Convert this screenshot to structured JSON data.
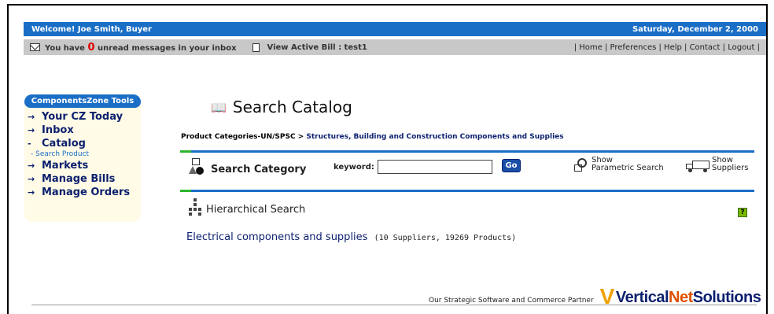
{
  "header": {
    "welcome": "Welcome! Joe Smith, Buyer",
    "date": "Saturday, December 2, 2000"
  },
  "subbar": {
    "msg_prefix": "You have",
    "unread_count": "0",
    "msg_suffix": "unread messages in your inbox",
    "active_bill": "View Active Bill : test1",
    "links": "| Home | Preferences | Help | Contact | Logout |"
  },
  "tools": {
    "title": "ComponentsZone Tools",
    "items": [
      {
        "label": "Your CZ Today",
        "arrow": "→"
      },
      {
        "label": "Inbox",
        "arrow": "→"
      },
      {
        "label": "Catalog",
        "arrow": "-"
      },
      {
        "label": "Markets",
        "arrow": "→"
      },
      {
        "label": "Manage Bills",
        "arrow": "→"
      },
      {
        "label": "Manage Orders",
        "arrow": "→"
      }
    ],
    "sub_item": "- Search Product"
  },
  "main": {
    "title": "Search Catalog",
    "crumb_root": "Product Categories-UN/SPSC",
    "crumb_sep": ">",
    "crumb_current": "Structures, Building and Construction Components and Supplies",
    "search_category": "Search Category",
    "keyword_label": "keyword:",
    "keyword_value": "",
    "go_label": "Go",
    "param_line1": "Show",
    "param_line2": "Parametric Search",
    "supp_line1": "Show",
    "supp_line2": "Suppliers",
    "hier_title": "Hierarchical Search",
    "help_label": "?",
    "result_link": "Electrical components and supplies",
    "result_meta": "(10 Suppliers,  19269 Products)"
  },
  "footer": {
    "partner_text": "Our Strategic Software and Commerce Partner",
    "logo_vertical": "Vertical",
    "logo_net": "Net",
    "logo_solutions": " Solutions"
  }
}
